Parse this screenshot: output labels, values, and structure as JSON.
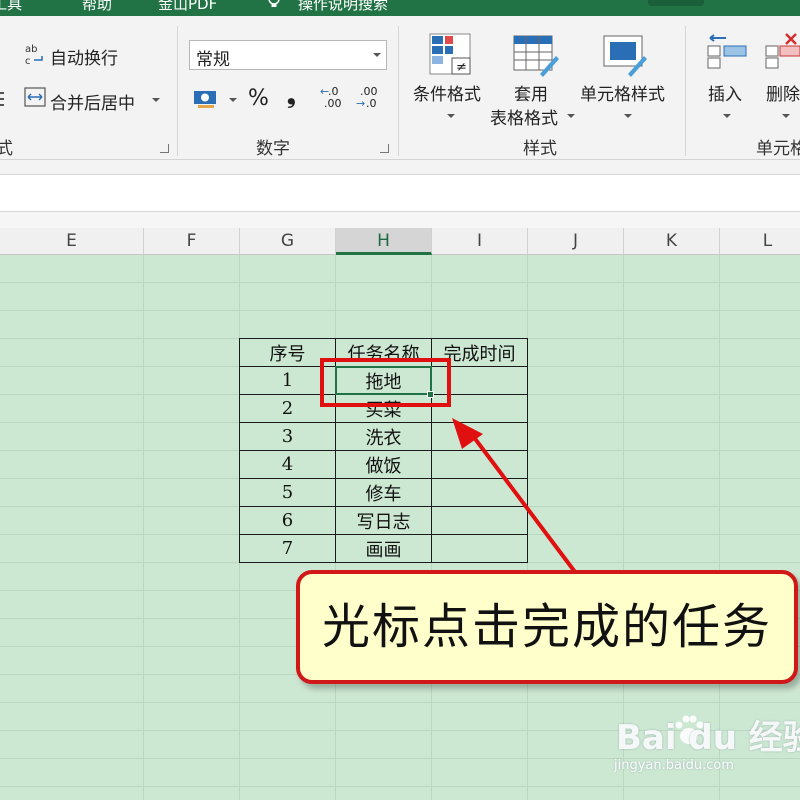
{
  "tabs": {
    "partial_left": "i工具",
    "help": "帮助",
    "pdf": "金山PDF",
    "tell_me": "操作说明搜索"
  },
  "ribbon": {
    "alignment": {
      "wrap_text": "自动换行",
      "merge_center": "合并后居中",
      "group_label_partial": "式"
    },
    "number": {
      "format_value": "常规",
      "percent": "%",
      "comma": "❟",
      "inc_decimal": ".00",
      "dec_decimal": ".0",
      "group_label": "数字"
    },
    "styles": {
      "conditional_format": "条件格式",
      "format_as_table_1": "套用",
      "format_as_table_2": "表格格式",
      "cell_styles": "单元格样式",
      "group_label": "样式"
    },
    "cells": {
      "insert": "插入",
      "delete": "删除",
      "group_label_partial": "单元格"
    }
  },
  "columns": [
    "E",
    "F",
    "G",
    "H",
    "I",
    "J",
    "K",
    "L"
  ],
  "selected_column": "H",
  "table": {
    "headers": [
      "序号",
      "任务名称",
      "完成时间"
    ],
    "rows": [
      [
        "1",
        "拖地",
        ""
      ],
      [
        "2",
        "买菜",
        ""
      ],
      [
        "3",
        "洗衣",
        ""
      ],
      [
        "4",
        "做饭",
        ""
      ],
      [
        "5",
        "修车",
        ""
      ],
      [
        "6",
        "写日志",
        ""
      ],
      [
        "7",
        "画画",
        ""
      ]
    ]
  },
  "callout": "光标点击完成的任务",
  "watermark": {
    "logo": "Bai du 经验",
    "url": "jingyan.baidu.com"
  },
  "colors": {
    "excel_green": "#217346",
    "grid_fill": "#cde8d2",
    "annotation_red": "#e01010",
    "callout_fill": "#ffffcc"
  }
}
